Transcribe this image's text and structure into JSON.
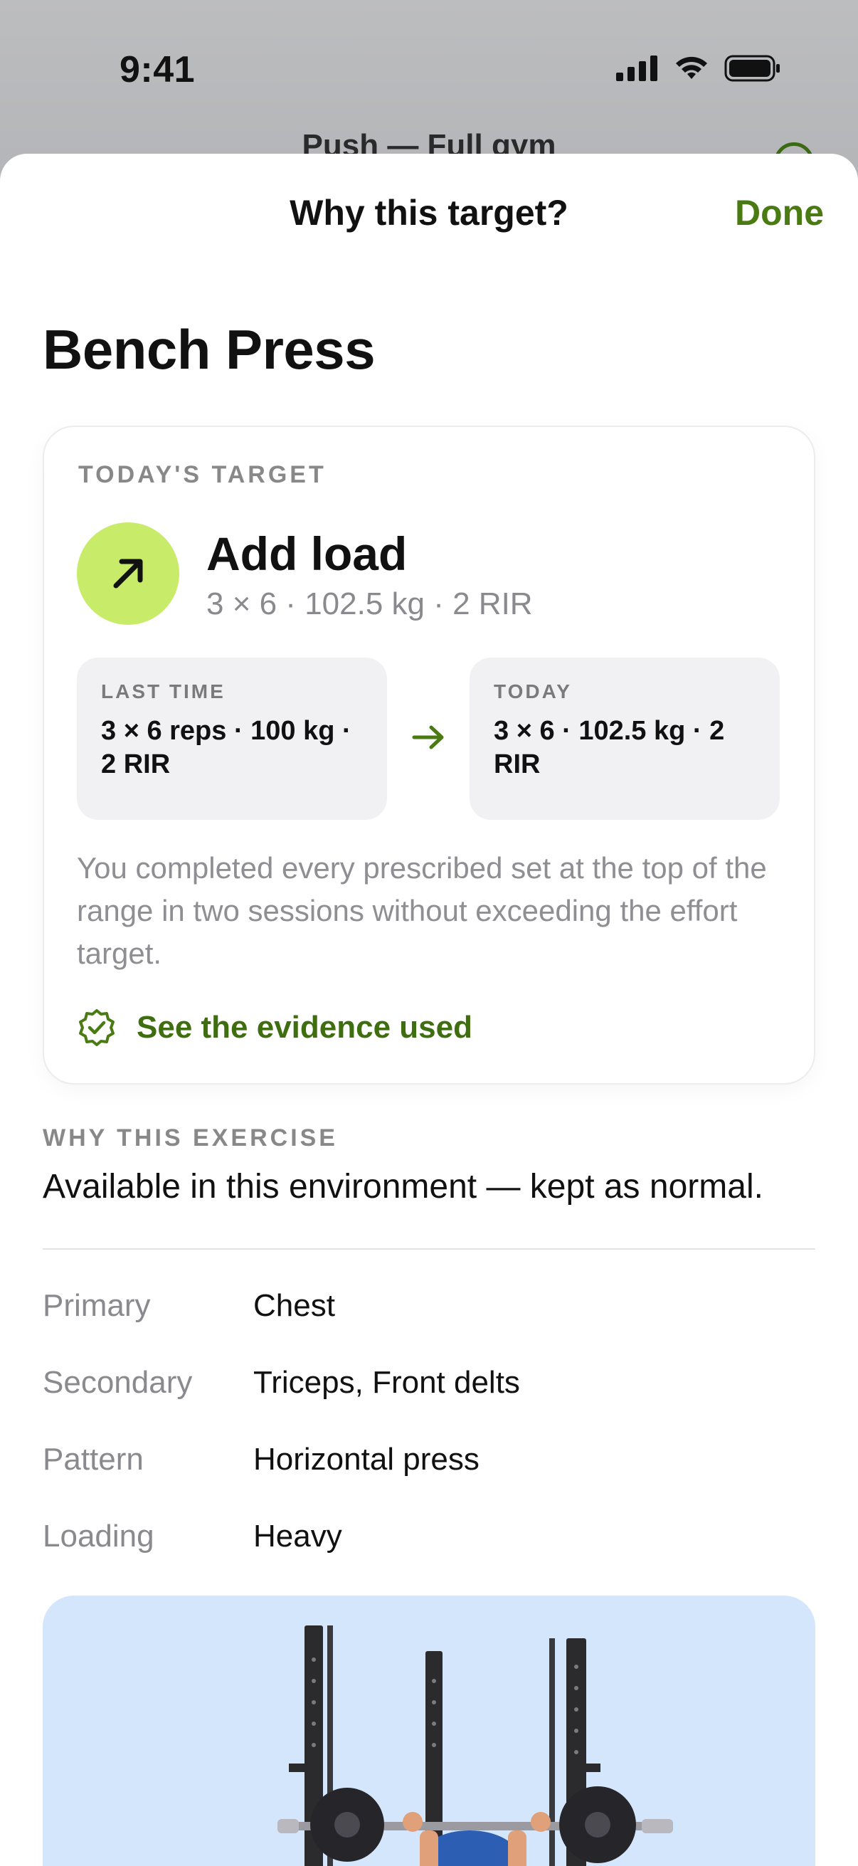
{
  "status_bar": {
    "time": "9:41"
  },
  "background_screen": {
    "title": "Push — Full gym"
  },
  "sheet": {
    "title": "Why this target?",
    "done_label": "Done"
  },
  "exercise": {
    "name": "Bench Press"
  },
  "target_card": {
    "section_label": "TODAY'S TARGET",
    "action_title": "Add load",
    "action_subtitle": "3 × 6 · 102.5 kg · 2 RIR",
    "last_time": {
      "label": "LAST TIME",
      "value": "3 × 6 reps · 100 kg · 2 RIR"
    },
    "today": {
      "label": "TODAY",
      "value": "3 × 6 · 102.5 kg · 2 RIR"
    },
    "explanation": "You completed every prescribed set at the top of the range in two sessions without exceeding the effort target.",
    "evidence_link": "See the evidence used"
  },
  "why_exercise": {
    "label": "WHY THIS EXERCISE",
    "text": "Available in this environment — kept as normal."
  },
  "details": [
    {
      "key": "Primary",
      "value": "Chest"
    },
    {
      "key": "Secondary",
      "value": "Triceps, Front delts"
    },
    {
      "key": "Pattern",
      "value": "Horizontal press"
    },
    {
      "key": "Loading",
      "value": "Heavy"
    }
  ],
  "icons": {
    "arrow": "arrow-up-right-icon",
    "compare_arrow": "arrow-right-icon",
    "evidence": "verified-badge-icon"
  },
  "colors": {
    "accent": "#4a7a12",
    "badge": "#c8ec6a",
    "illustration_bg": "#d3e6fb"
  }
}
